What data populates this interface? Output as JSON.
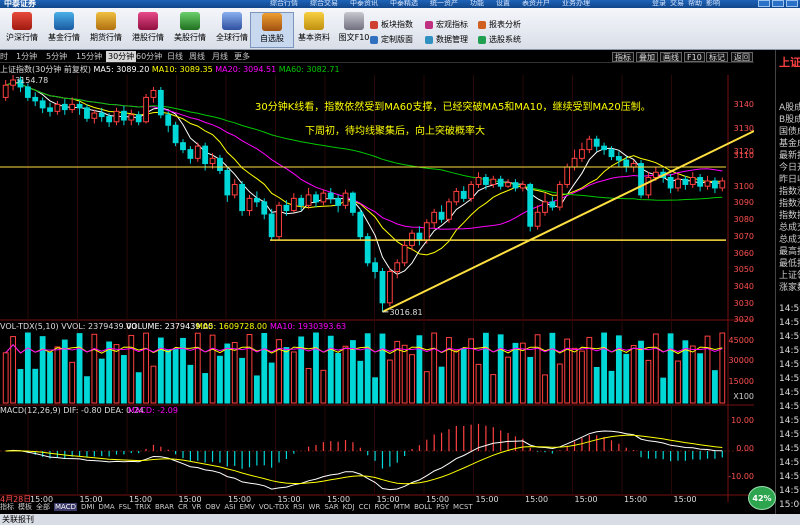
{
  "window": {
    "brand": "中泰证券",
    "menu": [
      "综合行情",
      "综合交易",
      "中泰资讯",
      "中泰精选",
      "统一资产",
      "功能",
      "设置",
      "表资开户",
      "业务办理"
    ],
    "actions": [
      "登录",
      "交易",
      "帮助",
      "影响"
    ]
  },
  "toolbar": {
    "buttons": [
      "沪深行情",
      "基金行情",
      "期货行情",
      "港股行情",
      "美股行情",
      "全球行情",
      "自选股",
      "基本资料",
      "图文F10"
    ],
    "active": "自选股",
    "list_col1": [
      "板块指数",
      "定制版面"
    ],
    "list_col2": [
      "宏观指标",
      "数据管理"
    ],
    "list_col3": [
      "报表分析",
      "选股系统"
    ]
  },
  "periods": {
    "items": [
      "时",
      "1分钟",
      "5分钟",
      "15分钟",
      "30分钟",
      "60分钟",
      "日线",
      "周线",
      "月线",
      "更多"
    ],
    "selected": "30分钟"
  },
  "right_buttons": [
    "指标",
    "叠加",
    "画线",
    "F10",
    "标记",
    "返回"
  ],
  "indicator_line": {
    "name": "上证指数(30分钟 前复权)",
    "ma5": "MA5: 3089.20",
    "ma10": "MA10: 3089.35",
    "ma20": "MA20: 3094.51",
    "ma60": "MA60: 3082.71"
  },
  "annotations": {
    "line1": "30分钟K线看，指数依然受到MA60支撑，已经突破MA5和MA10，继续受到MA20压制。",
    "line2": "下周初，待均线聚集后，向上突破概率大"
  },
  "price_axis": [
    "3140",
    "3130",
    "3120",
    "3110",
    "3100",
    "3090",
    "3080",
    "3070",
    "3060",
    "3050",
    "3040",
    "3030",
    "3020"
  ],
  "price_labels": {
    "high": "3154.78",
    "low": "3016.81"
  },
  "volume": {
    "line": "VOL-TDX(5,10) VVOL: 2379439.00",
    "volume": "VOLUME: 2379439.00",
    "ma5": "MA5: 1609728.00",
    "ma10": "MA10: 1930393.63",
    "axis": [
      "45000",
      "30000",
      "15000"
    ],
    "unit": "X100"
  },
  "macd": {
    "line": "MACD(12,26,9) DIF: -0.80 DEA: 0.24",
    "macd": "MACD: -2.09",
    "axis": [
      "10.00",
      "0.00",
      "-10.00"
    ]
  },
  "time_axis": [
    "4月28日",
    "15:00",
    "15:00",
    "15:00",
    "15:00",
    "15:00",
    "15:00",
    "15:00",
    "15:00",
    "15:00",
    "15:00",
    "15:00",
    "15:00",
    "15:00",
    "15:00"
  ],
  "tabs": [
    "指标",
    "模板",
    "全部",
    "MACD",
    "DMI",
    "DMA",
    "FSL",
    "TRIX",
    "BRAR",
    "CR",
    "VR",
    "OBV",
    "ASI",
    "EMV",
    "VOL-TDX",
    "RSI",
    "WR",
    "SAR",
    "KDJ",
    "CCI",
    "ROC",
    "MTM",
    "BOLL",
    "PSY",
    "MCST"
  ],
  "status": {
    "left": "关联报刊"
  },
  "right_panel": {
    "items": [
      "上证",
      "A股成",
      "B股成",
      "国债成",
      "基金成",
      "最新指",
      "今日开",
      "昨日收",
      "指数涨",
      "指数涨",
      "指数振",
      "总成交",
      "总成交",
      "最高指",
      "最低指",
      "上证领",
      "涨家数"
    ],
    "times": [
      "14:59",
      "14:59",
      "14:59",
      "14:59",
      "14:59",
      "14:59",
      "14:59",
      "14:59",
      "14:59",
      "14:59",
      "14:59",
      "14:59",
      "14:59",
      "14:59",
      "15:00"
    ]
  },
  "progress_badge": "42%",
  "colors": {
    "up": "#ff4040",
    "down": "#00d8d8",
    "ma5": "#ffffff",
    "ma10": "#ffff00",
    "ma20": "#ff00ff",
    "ma60": "#00c800",
    "annotation": "#ffff00",
    "trend": "#ffe040"
  },
  "chart_data": {
    "type": "candlestick",
    "title": "上证指数(30分钟 前复权)",
    "ylim": [
      3015,
      3150
    ],
    "candles": [
      {
        "o": 3140,
        "c": 3147,
        "h": 3150,
        "l": 3138
      },
      {
        "o": 3147,
        "c": 3150,
        "h": 3154.78,
        "l": 3144
      },
      {
        "o": 3150,
        "c": 3146,
        "h": 3152,
        "l": 3143
      },
      {
        "o": 3146,
        "c": 3140,
        "h": 3148,
        "l": 3138
      },
      {
        "o": 3140,
        "c": 3138,
        "h": 3143,
        "l": 3135
      },
      {
        "o": 3138,
        "c": 3134,
        "h": 3140,
        "l": 3131
      },
      {
        "o": 3134,
        "c": 3132,
        "h": 3137,
        "l": 3129
      },
      {
        "o": 3132,
        "c": 3136,
        "h": 3138,
        "l": 3130
      },
      {
        "o": 3136,
        "c": 3133,
        "h": 3139,
        "l": 3130
      },
      {
        "o": 3133,
        "c": 3136,
        "h": 3140,
        "l": 3131
      },
      {
        "o": 3136,
        "c": 3134,
        "h": 3138,
        "l": 3130
      },
      {
        "o": 3134,
        "c": 3128,
        "h": 3136,
        "l": 3126
      },
      {
        "o": 3128,
        "c": 3131,
        "h": 3133,
        "l": 3125
      },
      {
        "o": 3131,
        "c": 3129,
        "h": 3134,
        "l": 3126
      },
      {
        "o": 3129,
        "c": 3126,
        "h": 3131,
        "l": 3123
      },
      {
        "o": 3126,
        "c": 3132,
        "h": 3134,
        "l": 3124
      },
      {
        "o": 3132,
        "c": 3127,
        "h": 3135,
        "l": 3124
      },
      {
        "o": 3127,
        "c": 3130,
        "h": 3133,
        "l": 3124
      },
      {
        "o": 3130,
        "c": 3126,
        "h": 3132,
        "l": 3124
      },
      {
        "o": 3126,
        "c": 3140,
        "h": 3142,
        "l": 3125
      },
      {
        "o": 3140,
        "c": 3144,
        "h": 3146,
        "l": 3137
      },
      {
        "o": 3144,
        "c": 3130,
        "h": 3146,
        "l": 3128
      },
      {
        "o": 3130,
        "c": 3124,
        "h": 3132,
        "l": 3120
      },
      {
        "o": 3124,
        "c": 3114,
        "h": 3126,
        "l": 3112
      },
      {
        "o": 3114,
        "c": 3110,
        "h": 3116,
        "l": 3108
      },
      {
        "o": 3110,
        "c": 3105,
        "h": 3112,
        "l": 3102
      },
      {
        "o": 3105,
        "c": 3112,
        "h": 3114,
        "l": 3103
      },
      {
        "o": 3112,
        "c": 3102,
        "h": 3114,
        "l": 3098
      },
      {
        "o": 3102,
        "c": 3105,
        "h": 3108,
        "l": 3099
      },
      {
        "o": 3105,
        "c": 3098,
        "h": 3107,
        "l": 3096
      },
      {
        "o": 3098,
        "c": 3084,
        "h": 3100,
        "l": 3080
      },
      {
        "o": 3084,
        "c": 3090,
        "h": 3093,
        "l": 3082
      },
      {
        "o": 3090,
        "c": 3075,
        "h": 3092,
        "l": 3072
      },
      {
        "o": 3075,
        "c": 3082,
        "h": 3084,
        "l": 3072
      },
      {
        "o": 3082,
        "c": 3080,
        "h": 3086,
        "l": 3077
      },
      {
        "o": 3080,
        "c": 3073,
        "h": 3082,
        "l": 3070
      },
      {
        "o": 3073,
        "c": 3060,
        "h": 3076,
        "l": 3058
      },
      {
        "o": 3060,
        "c": 3078,
        "h": 3080,
        "l": 3058
      },
      {
        "o": 3078,
        "c": 3075,
        "h": 3081,
        "l": 3072
      },
      {
        "o": 3075,
        "c": 3082,
        "h": 3085,
        "l": 3074
      },
      {
        "o": 3082,
        "c": 3078,
        "h": 3084,
        "l": 3075
      },
      {
        "o": 3078,
        "c": 3084,
        "h": 3088,
        "l": 3076
      },
      {
        "o": 3084,
        "c": 3080,
        "h": 3086,
        "l": 3077
      },
      {
        "o": 3080,
        "c": 3085,
        "h": 3087,
        "l": 3078
      },
      {
        "o": 3085,
        "c": 3082,
        "h": 3088,
        "l": 3079
      },
      {
        "o": 3082,
        "c": 3078,
        "h": 3084,
        "l": 3074
      },
      {
        "o": 3078,
        "c": 3085,
        "h": 3087,
        "l": 3076
      },
      {
        "o": 3085,
        "c": 3074,
        "h": 3086,
        "l": 3072
      },
      {
        "o": 3074,
        "c": 3060,
        "h": 3076,
        "l": 3058
      },
      {
        "o": 3060,
        "c": 3045,
        "h": 3062,
        "l": 3043
      },
      {
        "o": 3045,
        "c": 3040,
        "h": 3048,
        "l": 3036
      },
      {
        "o": 3040,
        "c": 3022,
        "h": 3042,
        "l": 3016.81
      },
      {
        "o": 3022,
        "c": 3040,
        "h": 3042,
        "l": 3020
      },
      {
        "o": 3040,
        "c": 3045,
        "h": 3047,
        "l": 3036
      },
      {
        "o": 3045,
        "c": 3055,
        "h": 3058,
        "l": 3043
      },
      {
        "o": 3055,
        "c": 3062,
        "h": 3064,
        "l": 3052
      },
      {
        "o": 3062,
        "c": 3058,
        "h": 3066,
        "l": 3055
      },
      {
        "o": 3058,
        "c": 3068,
        "h": 3070,
        "l": 3056
      },
      {
        "o": 3068,
        "c": 3074,
        "h": 3076,
        "l": 3065
      },
      {
        "o": 3074,
        "c": 3070,
        "h": 3078,
        "l": 3068
      },
      {
        "o": 3070,
        "c": 3080,
        "h": 3082,
        "l": 3068
      },
      {
        "o": 3080,
        "c": 3086,
        "h": 3088,
        "l": 3078
      },
      {
        "o": 3086,
        "c": 3082,
        "h": 3089,
        "l": 3080
      },
      {
        "o": 3082,
        "c": 3090,
        "h": 3092,
        "l": 3080
      },
      {
        "o": 3090,
        "c": 3094,
        "h": 3097,
        "l": 3088
      },
      {
        "o": 3094,
        "c": 3090,
        "h": 3096,
        "l": 3087
      },
      {
        "o": 3090,
        "c": 3093,
        "h": 3095,
        "l": 3088
      },
      {
        "o": 3093,
        "c": 3089,
        "h": 3095,
        "l": 3087
      },
      {
        "o": 3089,
        "c": 3091,
        "h": 3093,
        "l": 3088
      },
      {
        "o": 3091,
        "c": 3088,
        "h": 3093,
        "l": 3086
      },
      {
        "o": 3088,
        "c": 3090,
        "h": 3092,
        "l": 3086
      },
      {
        "o": 3090,
        "c": 3066,
        "h": 3091,
        "l": 3063
      },
      {
        "o": 3066,
        "c": 3074,
        "h": 3078,
        "l": 3064
      },
      {
        "o": 3074,
        "c": 3080,
        "h": 3085,
        "l": 3072
      },
      {
        "o": 3080,
        "c": 3077,
        "h": 3083,
        "l": 3075
      },
      {
        "o": 3077,
        "c": 3090,
        "h": 3092,
        "l": 3075
      },
      {
        "o": 3090,
        "c": 3100,
        "h": 3102,
        "l": 3088
      },
      {
        "o": 3100,
        "c": 3105,
        "h": 3110,
        "l": 3098
      },
      {
        "o": 3105,
        "c": 3110,
        "h": 3114,
        "l": 3103
      },
      {
        "o": 3110,
        "c": 3116,
        "h": 3118,
        "l": 3108
      },
      {
        "o": 3116,
        "c": 3112,
        "h": 3118,
        "l": 3109
      },
      {
        "o": 3112,
        "c": 3110,
        "h": 3114,
        "l": 3107
      },
      {
        "o": 3110,
        "c": 3106,
        "h": 3112,
        "l": 3104
      },
      {
        "o": 3106,
        "c": 3104,
        "h": 3109,
        "l": 3100
      },
      {
        "o": 3104,
        "c": 3100,
        "h": 3106,
        "l": 3097
      },
      {
        "o": 3100,
        "c": 3102,
        "h": 3104,
        "l": 3097
      },
      {
        "o": 3102,
        "c": 3084,
        "h": 3104,
        "l": 3082
      },
      {
        "o": 3084,
        "c": 3094,
        "h": 3097,
        "l": 3082
      },
      {
        "o": 3094,
        "c": 3097,
        "h": 3100,
        "l": 3092
      },
      {
        "o": 3097,
        "c": 3094,
        "h": 3099,
        "l": 3091
      },
      {
        "o": 3094,
        "c": 3088,
        "h": 3096,
        "l": 3085
      },
      {
        "o": 3088,
        "c": 3093,
        "h": 3096,
        "l": 3086
      },
      {
        "o": 3093,
        "c": 3090,
        "h": 3095,
        "l": 3087
      },
      {
        "o": 3090,
        "c": 3094,
        "h": 3097,
        "l": 3088
      },
      {
        "o": 3094,
        "c": 3089,
        "h": 3096,
        "l": 3086
      },
      {
        "o": 3089,
        "c": 3092,
        "h": 3095,
        "l": 3087
      },
      {
        "o": 3092,
        "c": 3088,
        "h": 3094,
        "l": 3085
      },
      {
        "o": 3088,
        "c": 3092,
        "h": 3094,
        "l": 3086
      }
    ],
    "horizontal_lines": [
      3100,
      3058
    ],
    "trendline": [
      {
        "i": 51,
        "v": 3016.81
      },
      {
        "i": 101,
        "v": 3125
      }
    ]
  }
}
